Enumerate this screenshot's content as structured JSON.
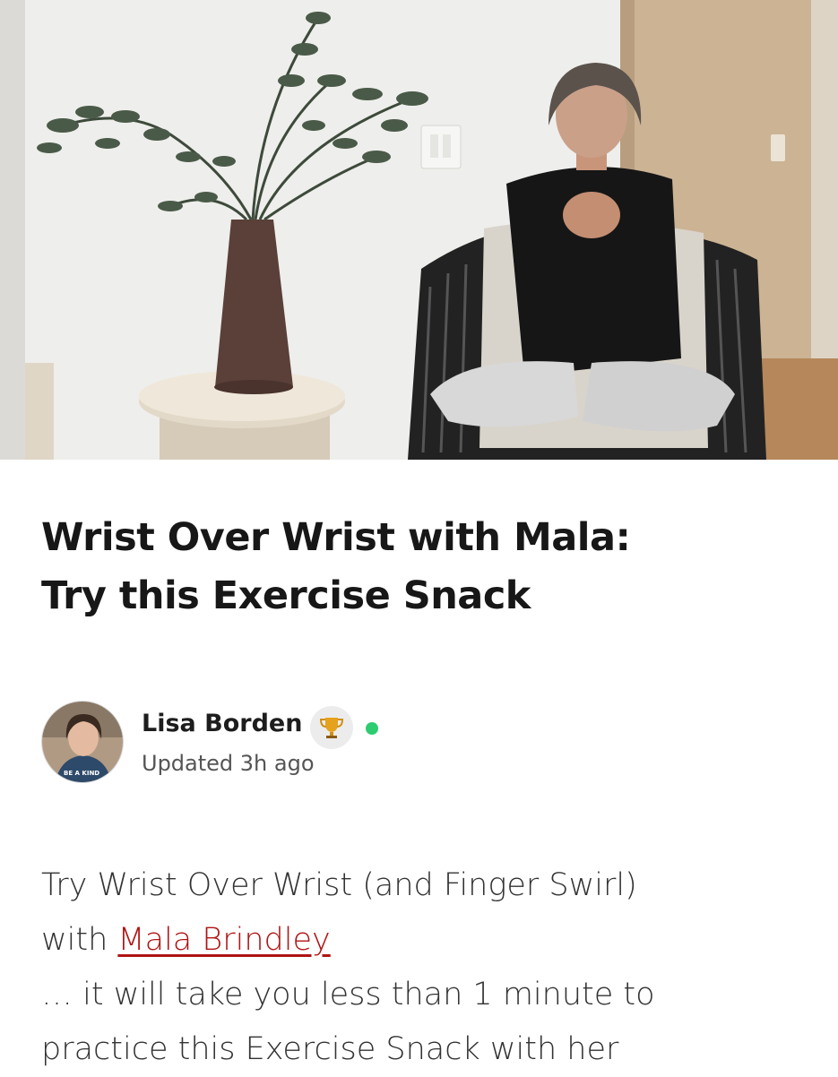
{
  "article": {
    "title_line1": "Wrist Over Wrist with Mala:",
    "title_line2": "Try this Exercise Snack",
    "hero_image_icon": "video-thumbnail-woman-seated-stretching"
  },
  "author": {
    "name": "Lisa Borden",
    "badge_icon": "trophy-icon",
    "status_color": "#2ecc71",
    "updated": "Updated 3h ago",
    "avatar_text": "BE A KIND HUMAN"
  },
  "body": {
    "line1": "Try Wrist Over Wrist (and Finger Swirl)",
    "line2_prefix": "with ",
    "link_text": "Mala Brindley",
    "line3": "… it will take you less than 1 minute to",
    "line4": "practice this Exercise Snack with her"
  },
  "colors": {
    "link": "#b01414",
    "title": "#171717",
    "body": "#333333"
  }
}
